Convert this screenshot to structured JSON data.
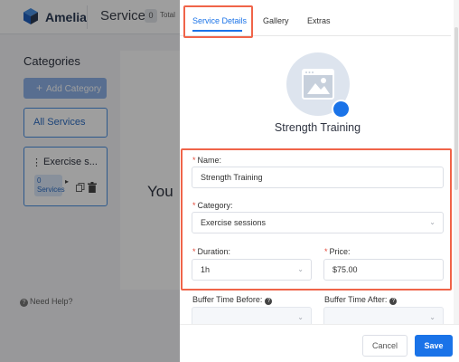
{
  "app": {
    "brand": "Amelia",
    "page_title": "Services",
    "services_count": "0",
    "total_label": "Total"
  },
  "categories": {
    "title": "Categories",
    "add_button": "Add Category",
    "all_services": "All Services",
    "items": [
      {
        "name": "Exercise s...",
        "count_number": "0",
        "count_label": "Services"
      }
    ]
  },
  "main": {
    "empty_text_fragment": "You"
  },
  "help": {
    "label": "Need Help?"
  },
  "dialog": {
    "tabs": [
      {
        "label": "Service Details",
        "active": true
      },
      {
        "label": "Gallery",
        "active": false
      },
      {
        "label": "Extras",
        "active": false
      }
    ],
    "service_name_title": "Strength Training",
    "fields": {
      "name": {
        "label": "Name:",
        "value": "Strength Training",
        "required": true
      },
      "category": {
        "label": "Category:",
        "value": "Exercise sessions",
        "required": true
      },
      "duration": {
        "label": "Duration:",
        "value": "1h",
        "required": true
      },
      "price": {
        "label": "Price:",
        "value": "$75.00",
        "required": true
      },
      "buffer_before": {
        "label": "Buffer Time Before:",
        "value": ""
      },
      "buffer_after": {
        "label": "Buffer Time After:",
        "value": ""
      }
    },
    "footer": {
      "cancel": "Cancel",
      "save": "Save"
    }
  },
  "colors": {
    "accent": "#1a73e8",
    "highlight": "#f06449",
    "required": "#e4493a"
  }
}
